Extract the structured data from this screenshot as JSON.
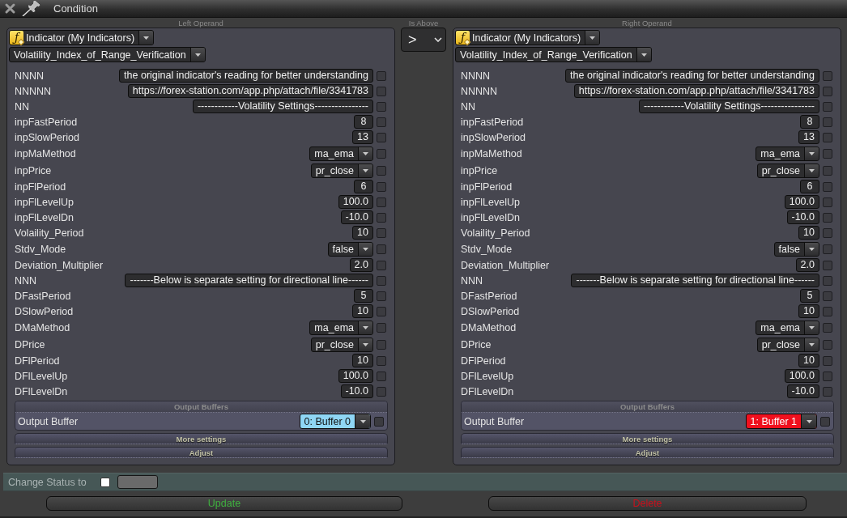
{
  "window": {
    "title": "Condition"
  },
  "left_operand": {
    "heading": "Left Operand",
    "source": {
      "icon": "ƒ",
      "label": "Indicator (My Indicators)"
    },
    "indicator": "Volatility_Index_of_Range_Verification",
    "parameters": [
      {
        "name": "NNNN",
        "kind": "text",
        "value": "the original indicator's reading for better understanding",
        "checked": false
      },
      {
        "name": "NNNNN",
        "kind": "text",
        "value": "https://forex-station.com/app.php/attach/file/3341783",
        "checked": false
      },
      {
        "name": "NN",
        "kind": "text",
        "value": "------------Volatility Settings----------------",
        "checked": false
      },
      {
        "name": "inpFastPeriod",
        "kind": "text",
        "value": "8",
        "checked": false
      },
      {
        "name": "inpSlowPeriod",
        "kind": "text",
        "value": "13",
        "checked": false
      },
      {
        "name": "inpMaMethod",
        "kind": "select",
        "value": "ma_ema",
        "checked": false
      },
      {
        "name": "inpPrice",
        "kind": "select",
        "value": "pr_close",
        "checked": false
      },
      {
        "name": "inpFlPeriod",
        "kind": "text",
        "value": "6",
        "checked": false
      },
      {
        "name": "inpFlLevelUp",
        "kind": "text",
        "value": "100.0",
        "checked": false
      },
      {
        "name": "inpFlLevelDn",
        "kind": "text",
        "value": "-10.0",
        "checked": false
      },
      {
        "name": "Volaility_Period",
        "kind": "text",
        "value": "10",
        "checked": false
      },
      {
        "name": "Stdv_Mode",
        "kind": "select",
        "value": "false",
        "checked": false
      },
      {
        "name": "Deviation_Multiplier",
        "kind": "text",
        "value": "2.0",
        "checked": false
      },
      {
        "name": "NNN",
        "kind": "text",
        "value": "-------Below is separate setting for directional line------",
        "checked": false
      },
      {
        "name": "DFastPeriod",
        "kind": "text",
        "value": "5",
        "checked": false
      },
      {
        "name": "DSlowPeriod",
        "kind": "text",
        "value": "10",
        "checked": false
      },
      {
        "name": "DMaMethod",
        "kind": "select",
        "value": "ma_ema",
        "checked": false
      },
      {
        "name": "DPrice",
        "kind": "select",
        "value": "pr_close",
        "checked": false
      },
      {
        "name": "DFlPeriod",
        "kind": "text",
        "value": "10",
        "checked": false
      },
      {
        "name": "DFlLevelUp",
        "kind": "text",
        "value": "100.0",
        "checked": false
      },
      {
        "name": "DFlLevelDn",
        "kind": "text",
        "value": "-10.0",
        "checked": false
      }
    ],
    "output_buffers": {
      "title": "Output Buffers",
      "label": "Output Buffer",
      "value": "0: Buffer 0",
      "color": "#8fd6f5",
      "checked": false
    },
    "sections": [
      "More settings",
      "Adjust"
    ]
  },
  "operator": {
    "heading": "Is Above",
    "value": ">"
  },
  "right_operand": {
    "heading": "Right Operand",
    "source": {
      "icon": "ƒ",
      "label": "Indicator (My Indicators)"
    },
    "indicator": "Volatility_Index_of_Range_Verification",
    "parameters": [
      {
        "name": "NNNN",
        "kind": "text",
        "value": "the original indicator's reading for better understanding",
        "checked": false
      },
      {
        "name": "NNNNN",
        "kind": "text",
        "value": "https://forex-station.com/app.php/attach/file/3341783",
        "checked": false
      },
      {
        "name": "NN",
        "kind": "text",
        "value": "------------Volatility Settings----------------",
        "checked": false
      },
      {
        "name": "inpFastPeriod",
        "kind": "text",
        "value": "8",
        "checked": false
      },
      {
        "name": "inpSlowPeriod",
        "kind": "text",
        "value": "13",
        "checked": false
      },
      {
        "name": "inpMaMethod",
        "kind": "select",
        "value": "ma_ema",
        "checked": false
      },
      {
        "name": "inpPrice",
        "kind": "select",
        "value": "pr_close",
        "checked": false
      },
      {
        "name": "inpFlPeriod",
        "kind": "text",
        "value": "6",
        "checked": false
      },
      {
        "name": "inpFlLevelUp",
        "kind": "text",
        "value": "100.0",
        "checked": false
      },
      {
        "name": "inpFlLevelDn",
        "kind": "text",
        "value": "-10.0",
        "checked": false
      },
      {
        "name": "Volaility_Period",
        "kind": "text",
        "value": "10",
        "checked": false
      },
      {
        "name": "Stdv_Mode",
        "kind": "select",
        "value": "false",
        "checked": false
      },
      {
        "name": "Deviation_Multiplier",
        "kind": "text",
        "value": "2.0",
        "checked": false
      },
      {
        "name": "NNN",
        "kind": "text",
        "value": "-------Below is separate setting for directional line------",
        "checked": false
      },
      {
        "name": "DFastPeriod",
        "kind": "text",
        "value": "5",
        "checked": false
      },
      {
        "name": "DSlowPeriod",
        "kind": "text",
        "value": "10",
        "checked": false
      },
      {
        "name": "DMaMethod",
        "kind": "select",
        "value": "ma_ema",
        "checked": false
      },
      {
        "name": "DPrice",
        "kind": "select",
        "value": "pr_close",
        "checked": false
      },
      {
        "name": "DFlPeriod",
        "kind": "text",
        "value": "10",
        "checked": false
      },
      {
        "name": "DFlLevelUp",
        "kind": "text",
        "value": "100.0",
        "checked": false
      },
      {
        "name": "DFlLevelDn",
        "kind": "text",
        "value": "-10.0",
        "checked": false
      }
    ],
    "output_buffers": {
      "title": "Output Buffers",
      "label": "Output Buffer",
      "value": "1: Buffer 1",
      "color": "#f0101e",
      "checked": false
    },
    "sections": [
      "More settings",
      "Adjust"
    ]
  },
  "status": {
    "label": "Change Status to",
    "checked": false
  },
  "buttons": [
    {
      "label": "Update",
      "kind": "update"
    },
    {
      "label": "Delete",
      "kind": "delete"
    }
  ]
}
